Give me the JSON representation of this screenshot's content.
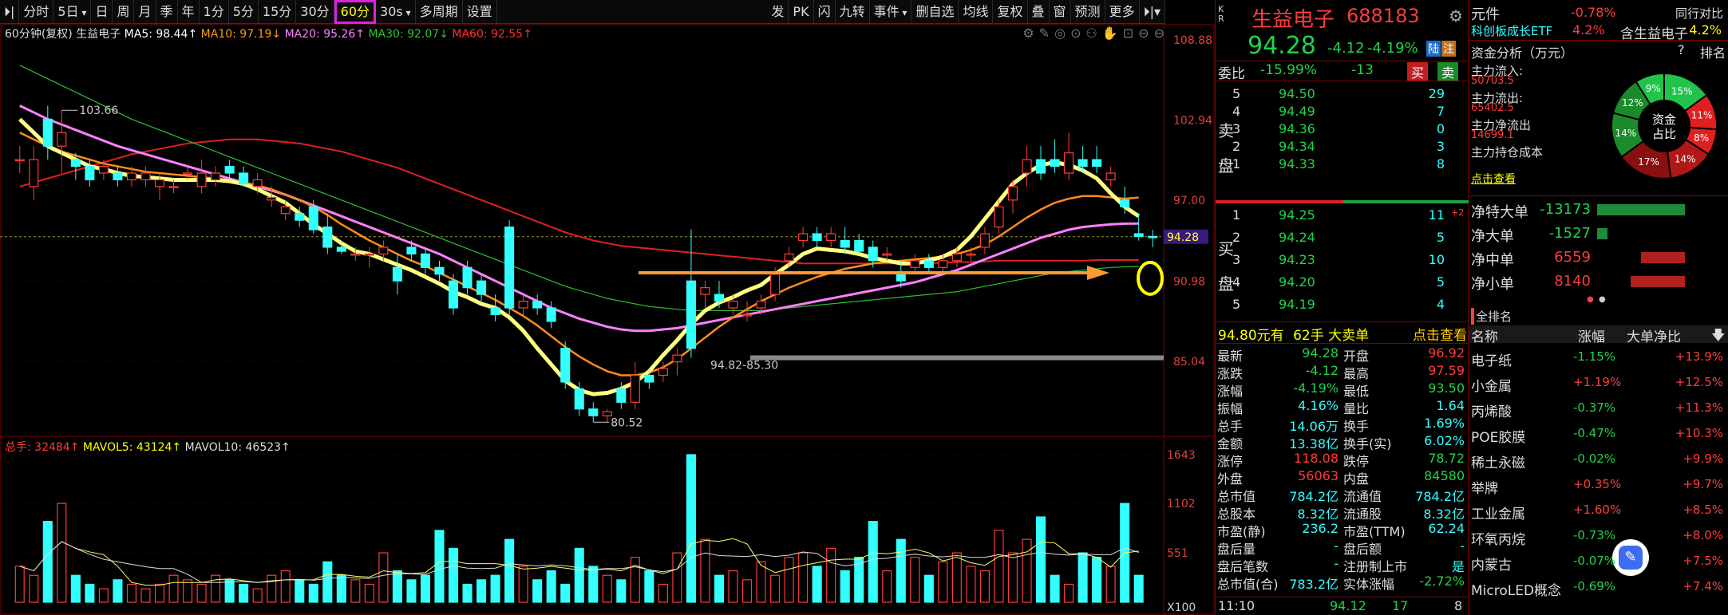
{
  "toolbar": {
    "items": [
      "分时",
      "5日",
      "日",
      "周",
      "月",
      "季",
      "年",
      "1分",
      "5分",
      "15分",
      "30分",
      "60分",
      "30s",
      "多周期",
      "设置"
    ],
    "right": [
      "发",
      "PK",
      "闪",
      "九转",
      "事件",
      "删自选",
      "均线",
      "复权",
      "叠",
      "窗",
      "预测",
      "更多"
    ]
  },
  "legend": {
    "period": "60分钟(复权)",
    "name": "生益电子",
    "ma5": "MA5: 98.44↑",
    "ma10": "MA10: 97.19↓",
    "ma20": "MA20: 95.26↑",
    "ma30": "MA30: 92.07↓",
    "ma60": "MA60: 92.55↑"
  },
  "y_labels": [
    "108.88",
    "102.94",
    "97.00",
    "90.98",
    "85.04"
  ],
  "current_price_tag": "94.28",
  "high_label": "103.66",
  "low_label": "80.52",
  "range_label": "94.82-85.30",
  "vol": {
    "total": "总手: 32484↑",
    "mavol5": "MAVOL5: 43124↑",
    "mavol10": "MAVOL10: 46523↑",
    "y_labels": [
      "1643",
      "1102",
      "551"
    ],
    "unit": "X100"
  },
  "stock": {
    "name": "生益电子",
    "code": "688183",
    "price": "94.28",
    "change": "-4.12",
    "pct": "-4.19%",
    "tag_lu": "陆",
    "tag_zhu": "注",
    "kr": "K R"
  },
  "weibi": {
    "label": "委比",
    "value": "-15.99%",
    "diff": "-13",
    "buy": "买",
    "sell": "卖"
  },
  "sell_book": [
    [
      "5",
      "94.50",
      "29"
    ],
    [
      "4",
      "94.49",
      "7"
    ],
    [
      "3",
      "94.36",
      "0"
    ],
    [
      "2",
      "94.34",
      "3"
    ],
    [
      "1",
      "94.33",
      "8"
    ]
  ],
  "sell_label": [
    "卖",
    "盘"
  ],
  "buy_book": [
    [
      "1",
      "94.25",
      "11",
      "+2"
    ],
    [
      "2",
      "94.24",
      "5",
      ""
    ],
    [
      "3",
      "94.23",
      "10",
      ""
    ],
    [
      "4",
      "94.20",
      "5",
      ""
    ],
    [
      "5",
      "94.19",
      "4",
      ""
    ]
  ],
  "buy_label": [
    "买",
    "盘"
  ],
  "big_order": {
    "amount": "94.80元有",
    "hands": "62手",
    "label": "大卖单",
    "link": "点击查看"
  },
  "quote": [
    [
      "最新",
      "94.28",
      "开盘",
      "96.92"
    ],
    [
      "涨跌",
      "-4.12",
      "最高",
      "97.59"
    ],
    [
      "涨幅",
      "-4.19%",
      "最低",
      "93.50"
    ],
    [
      "振幅",
      "4.16%",
      "量比",
      "1.64"
    ],
    [
      "总手",
      "14.06万",
      "换手",
      "1.69%"
    ],
    [
      "金额",
      "13.38亿",
      "换手(实)",
      "6.02%"
    ],
    [
      "涨停",
      "118.08",
      "跌停",
      "78.72"
    ],
    [
      "外盘",
      "56063",
      "内盘",
      "84580"
    ],
    [
      "总市值",
      "784.2亿",
      "流通值",
      "784.2亿"
    ],
    [
      "总股本",
      "8.32亿",
      "流通股",
      "8.32亿"
    ],
    [
      "市盈(静)",
      "236.2",
      "市盈(TTM)",
      "62.24"
    ],
    [
      "盘后量",
      "-",
      "盘后额",
      "-"
    ],
    [
      "盘后笔数",
      "-",
      "注册制上市",
      "是"
    ],
    [
      "总市值(合)",
      "783.2亿",
      "实体涨幅",
      "-2.72%"
    ]
  ],
  "tick": {
    "time": "11:10",
    "price": "94.12",
    "vol": "17",
    "n": "8"
  },
  "right_panel": {
    "yuanjian": "元件",
    "yj_pct": "-0.78%",
    "tongxing": "同行对比",
    "etf": "科创板成长ETF",
    "etf_pct": "4.2%",
    "contains": "含生益电子",
    "fund_title": "资金分析（万元）",
    "help": "?",
    "rank_tab": "排名",
    "flows": [
      [
        "主力流入:",
        "50703.5"
      ],
      [
        "主力流出:",
        "65402.5"
      ],
      [
        "主力净流出",
        "14699.1"
      ],
      [
        "主力持仓成本",
        ""
      ]
    ],
    "click_view": "点击查看",
    "donut_center": [
      "资金",
      "占比"
    ],
    "donut_pcts": [
      "15%",
      "11%",
      "8%",
      "14%",
      "17%",
      "14%",
      "12%",
      "9%"
    ],
    "nets": [
      [
        "净特大单",
        "-13173",
        -13173
      ],
      [
        "净大单",
        "-1527",
        -1527
      ],
      [
        "净中单",
        "6559",
        6559
      ],
      [
        "净小单",
        "8140",
        8140
      ]
    ],
    "sector_title": "全排名",
    "sector_headers": [
      "名称",
      "涨幅",
      "大单净比"
    ],
    "sectors": [
      [
        "电子纸",
        "-1.15%",
        "+13.9%"
      ],
      [
        "小金属",
        "+1.19%",
        "+12.5%"
      ],
      [
        "丙烯酸",
        "-0.37%",
        "+11.3%"
      ],
      [
        "POE胶膜",
        "-0.47%",
        "+10.3%"
      ],
      [
        "稀土永磁",
        "-0.02%",
        "+9.9%"
      ],
      [
        "举牌",
        "+0.35%",
        "+9.7%"
      ],
      [
        "工业金属",
        "+1.60%",
        "+8.5%"
      ],
      [
        "环氧丙烷",
        "-0.73%",
        "+8.0%"
      ],
      [
        "内蒙古",
        "-0.07%",
        "+7.5%"
      ],
      [
        "MicroLED概念",
        "-0.69%",
        "+7.4%"
      ]
    ]
  },
  "colors": {
    "up": "#ff3c3c",
    "down": "#3ff",
    "ma5": "#fff",
    "ma10": "#f80",
    "ma20": "#ff80ff",
    "ma30": "#2ec22e",
    "ma60": "#e02020"
  },
  "chart_data": {
    "type": "candlestick",
    "title": "生益电子 60分钟",
    "ylim": [
      79,
      109
    ],
    "ohlc": [
      [
        100,
        101,
        99,
        100
      ],
      [
        98,
        101,
        97,
        100
      ],
      [
        103,
        104,
        100,
        101
      ],
      [
        101,
        103.66,
        99,
        102
      ],
      [
        100,
        100.5,
        98.5,
        99.5
      ],
      [
        99.5,
        100,
        98,
        98.5
      ],
      [
        99,
        100,
        98.5,
        99.5
      ],
      [
        99,
        99.5,
        98,
        98.5
      ],
      [
        98.5,
        99.5,
        98,
        99
      ],
      [
        98.5,
        99.5,
        98,
        99
      ],
      [
        98,
        99,
        97,
        98.5
      ],
      [
        98,
        98.5,
        97.5,
        98
      ],
      [
        99,
        99.5,
        98.5,
        99
      ],
      [
        98,
        100,
        97.5,
        99
      ],
      [
        98.5,
        99.5,
        98,
        99
      ],
      [
        99.5,
        100,
        98.5,
        99
      ],
      [
        99,
        99.5,
        98,
        98.2
      ],
      [
        98,
        99,
        97.5,
        98.5
      ],
      [
        97,
        98,
        96.5,
        97.2
      ],
      [
        96,
        97,
        95.5,
        96.5
      ],
      [
        96,
        96.5,
        95,
        95.5
      ],
      [
        96.5,
        97,
        94.5,
        94.8
      ],
      [
        95,
        96,
        93,
        93.5
      ],
      [
        93.5,
        94,
        93,
        93.2
      ],
      [
        93,
        93.5,
        92.5,
        93
      ],
      [
        93,
        93.5,
        92,
        93
      ],
      [
        93,
        94,
        92.5,
        93.5
      ],
      [
        92,
        93,
        90,
        91
      ],
      [
        93.5,
        94,
        92.5,
        93
      ],
      [
        93,
        93.5,
        91.5,
        92
      ],
      [
        92,
        92.5,
        91,
        91.5
      ],
      [
        91,
        91.5,
        88.5,
        89
      ],
      [
        92,
        92.5,
        90,
        90.5
      ],
      [
        91,
        91.5,
        89.5,
        90
      ],
      [
        89,
        90,
        88,
        88.5
      ],
      [
        95,
        95.5,
        88.5,
        89
      ],
      [
        89,
        90,
        88.5,
        89.5
      ],
      [
        89.5,
        90,
        88.5,
        89
      ],
      [
        89,
        89.5,
        87.5,
        88
      ],
      [
        86,
        86.5,
        83,
        83.5
      ],
      [
        83,
        83.5,
        81,
        81.5
      ],
      [
        81.5,
        82,
        80.52,
        81
      ],
      [
        81,
        81.5,
        80.52,
        81.3
      ],
      [
        83,
        83.5,
        81.5,
        82
      ],
      [
        82,
        85,
        81.5,
        84
      ],
      [
        84,
        84.5,
        83,
        83.5
      ],
      [
        84,
        85,
        83.5,
        84.5
      ],
      [
        85,
        86,
        84,
        85.5
      ],
      [
        91,
        94.82,
        85.3,
        86
      ],
      [
        90,
        91,
        89,
        90.5
      ],
      [
        90,
        91,
        89,
        89.5
      ],
      [
        89,
        90,
        88.5,
        89.5
      ],
      [
        88.5,
        89.5,
        88,
        88.5
      ],
      [
        89,
        90,
        88.5,
        89.5
      ],
      [
        90,
        92,
        89.5,
        91.5
      ],
      [
        92.5,
        93.5,
        92,
        93
      ],
      [
        94,
        95,
        93.5,
        94.5
      ],
      [
        94.5,
        95,
        93.5,
        94
      ],
      [
        94,
        95,
        93.5,
        94.5
      ],
      [
        94,
        95,
        93,
        93.5
      ],
      [
        94,
        94.5,
        93,
        93.2
      ],
      [
        93.5,
        94,
        92,
        92.5
      ],
      [
        93,
        93.5,
        92.5,
        93
      ],
      [
        91.5,
        92.5,
        90.5,
        91
      ],
      [
        92,
        93,
        91.5,
        92.5
      ],
      [
        92.5,
        93,
        91.5,
        92
      ],
      [
        92,
        93,
        91.5,
        92.5
      ],
      [
        92.5,
        93.5,
        92,
        93
      ],
      [
        93,
        93.5,
        92.5,
        93
      ],
      [
        93.5,
        95,
        93,
        94.5
      ],
      [
        95,
        97,
        94.5,
        96.5
      ],
      [
        97,
        98.5,
        96,
        98
      ],
      [
        99,
        101,
        98,
        100
      ],
      [
        100,
        101,
        98.5,
        99
      ],
      [
        100,
        101.5,
        99,
        99.5
      ],
      [
        99,
        102,
        98.5,
        100.5
      ],
      [
        100,
        101,
        99,
        99.5
      ],
      [
        100,
        101,
        99,
        99.5
      ],
      [
        98.5,
        99.5,
        98,
        99
      ],
      [
        97,
        98,
        96,
        96.5
      ],
      [
        94.5,
        96,
        94,
        94.3
      ],
      [
        94.3,
        94.8,
        93.5,
        94.28
      ]
    ],
    "ma5": [
      103,
      102,
      101,
      100.5,
      100,
      99.5,
      99.3,
      99,
      98.8,
      98.7,
      98.6,
      98.5,
      98.5,
      98.5,
      98.5,
      98.4,
      98.2,
      97.8,
      97.3,
      96.8,
      96,
      95.2,
      94.5,
      93.8,
      93.2,
      93,
      92.6,
      92.2,
      91.8,
      91.3,
      90.8,
      90.2,
      89.8,
      89.3,
      89,
      88.3,
      87.3,
      86,
      84.8,
      83.6,
      82.9,
      82.6,
      82.7,
      83,
      83.5,
      84.3,
      85.5,
      86.6,
      87.8,
      88.8,
      89.4,
      89.8,
      90.3,
      90.7,
      91.5,
      92.2,
      93,
      93.4,
      93.3,
      93.2,
      93,
      92.7,
      92.5,
      92.3,
      92.3,
      92.5,
      92.8,
      93.3,
      94.3,
      95.6,
      96.9,
      98.2,
      99,
      99.6,
      99.8,
      99.6,
      99.2,
      98.6,
      97.5,
      96.5,
      95.8
    ],
    "ma10": [
      102,
      101.5,
      101,
      100.6,
      100.3,
      100,
      99.7,
      99.5,
      99.3,
      99.1,
      99,
      98.9,
      98.8,
      98.7,
      98.6,
      98.5,
      98.3,
      98.1,
      97.8,
      97.4,
      97,
      96.5,
      95.9,
      95.2,
      94.6,
      94,
      93.5,
      93,
      92.5,
      92.1,
      91.6,
      91.1,
      90.6,
      90.1,
      89.6,
      89,
      88.4,
      87.7,
      86.9,
      86.1,
      85.4,
      84.8,
      84.3,
      84,
      84,
      84.2,
      84.6,
      85.2,
      86,
      86.8,
      87.6,
      88.3,
      88.9,
      89.5,
      90,
      90.5,
      90.9,
      91.3,
      91.6,
      91.9,
      92.1,
      92.3,
      92.4,
      92.5,
      92.6,
      92.7,
      92.8,
      93,
      93.3,
      93.7,
      94.3,
      95,
      95.7,
      96.3,
      96.8,
      97.1,
      97.3,
      97.3,
      97.2,
      97.1,
      97.19
    ],
    "ma20": [
      104,
      103.5,
      103,
      102.6,
      102.2,
      101.8,
      101.4,
      101,
      100.7,
      100.4,
      100.1,
      99.8,
      99.5,
      99.2,
      98.9,
      98.6,
      98.3,
      98,
      97.7,
      97.4,
      97,
      96.6,
      96.2,
      95.8,
      95.4,
      95,
      94.6,
      94.2,
      93.8,
      93.4,
      93,
      92.5,
      92,
      91.5,
      91,
      90.5,
      90,
      89.5,
      89,
      88.6,
      88.2,
      87.9,
      87.6,
      87.4,
      87.3,
      87.3,
      87.4,
      87.5,
      87.7,
      87.9,
      88.1,
      88.3,
      88.5,
      88.7,
      88.9,
      89.1,
      89.3,
      89.5,
      89.7,
      89.9,
      90.1,
      90.3,
      90.5,
      90.7,
      90.9,
      91.2,
      91.5,
      91.8,
      92.2,
      92.6,
      93,
      93.4,
      93.8,
      94.2,
      94.5,
      94.8,
      95,
      95.1,
      95.2,
      95.25,
      95.26
    ],
    "ma30": [
      107,
      106.5,
      106,
      105.5,
      105,
      104.5,
      104,
      103.5,
      103,
      102.6,
      102.2,
      101.8,
      101.4,
      101,
      100.6,
      100.2,
      99.8,
      99.4,
      99,
      98.6,
      98.2,
      97.8,
      97.4,
      97,
      96.6,
      96.2,
      95.8,
      95.4,
      95,
      94.6,
      94.2,
      93.8,
      93.4,
      93,
      92.6,
      92.2,
      91.8,
      91.4,
      91,
      90.6,
      90.3,
      90,
      89.7,
      89.5,
      89.3,
      89.1,
      89,
      88.9,
      88.8,
      88.8,
      88.8,
      88.8,
      88.8,
      88.8,
      88.9,
      89,
      89.1,
      89.2,
      89.3,
      89.4,
      89.5,
      89.6,
      89.7,
      89.8,
      89.9,
      90,
      90.1,
      90.2,
      90.4,
      90.6,
      90.8,
      91,
      91.2,
      91.4,
      91.6,
      91.7,
      91.8,
      91.9,
      92,
      92.05,
      92.07
    ],
    "ma60": [
      98,
      98.3,
      98.6,
      98.9,
      99.2,
      99.5,
      99.8,
      100.1,
      100.4,
      100.6,
      100.8,
      101,
      101.2,
      101.3,
      101.4,
      101.5,
      101.5,
      101.5,
      101.4,
      101.3,
      101.2,
      101,
      100.8,
      100.6,
      100.3,
      100,
      99.7,
      99.4,
      99,
      98.6,
      98.2,
      97.8,
      97.4,
      97,
      96.6,
      96.2,
      95.8,
      95.4,
      95,
      94.6,
      94.3,
      94,
      93.8,
      93.6,
      93.5,
      93.4,
      93.3,
      93.2,
      93.1,
      93,
      92.9,
      92.8,
      92.7,
      92.6,
      92.5,
      92.4,
      92.3,
      92.3,
      92.3,
      92.3,
      92.3,
      92.3,
      92.3,
      92.3,
      92.3,
      92.3,
      92.35,
      92.4,
      92.4,
      92.45,
      92.5,
      92.5,
      92.5,
      92.5,
      92.5,
      92.5,
      92.5,
      92.55,
      92.55,
      92.55,
      92.55
    ],
    "volume": [
      400,
      300,
      900,
      1100,
      300,
      200,
      150,
      250,
      200,
      150,
      200,
      300,
      250,
      200,
      300,
      250,
      200,
      150,
      300,
      350,
      250,
      200,
      450,
      300,
      250,
      200,
      550,
      350,
      250,
      300,
      800,
      600,
      200,
      250,
      300,
      700,
      400,
      250,
      350,
      200,
      600,
      400,
      300,
      250,
      500,
      350,
      200,
      550,
      1643,
      700,
      300,
      350,
      250,
      450,
      300,
      500,
      550,
      400,
      600,
      350,
      500,
      900,
      350,
      700,
      500,
      300,
      450,
      550,
      400,
      350,
      800,
      550,
      700,
      950,
      300,
      200,
      550,
      500,
      400,
      1100,
      300
    ]
  }
}
